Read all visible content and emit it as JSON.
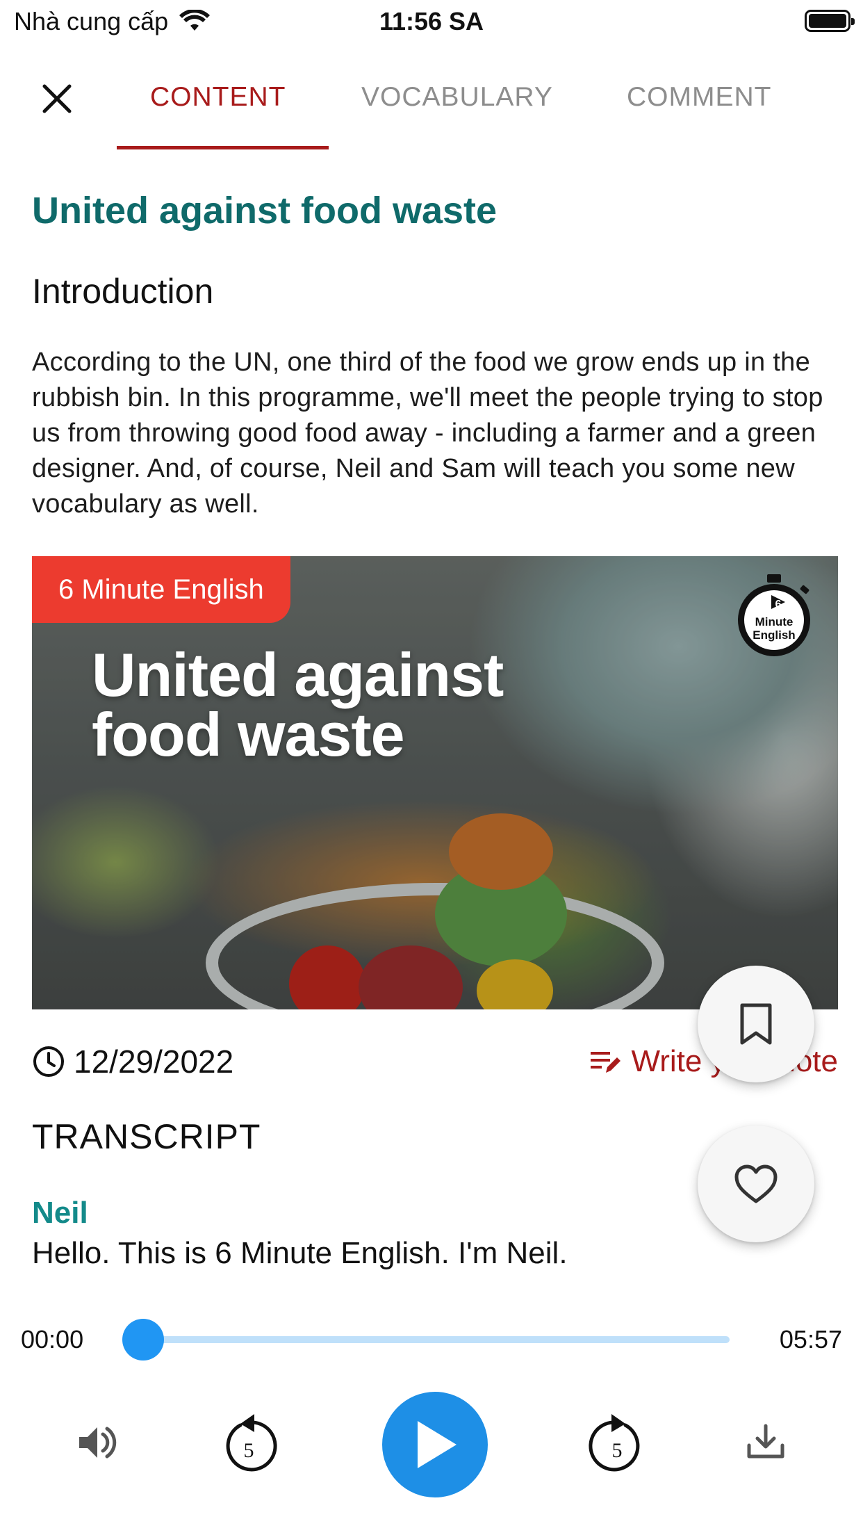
{
  "status_bar": {
    "carrier": "Nhà cung cấp",
    "time": "11:56 SA"
  },
  "tabs": [
    {
      "label": "CONTENT",
      "active": true
    },
    {
      "label": "VOCABULARY",
      "active": false
    },
    {
      "label": "COMMENT",
      "active": false
    }
  ],
  "article": {
    "title": "United against food waste",
    "intro_heading": "Introduction",
    "intro_body": "According to the UN, one third of the food we grow ends up in the rubbish bin. In this programme, we'll meet the people trying to stop us from throwing good food away - including a farmer and a green designer. And, of course, Neil and Sam will teach you some new vocabulary as well.",
    "image": {
      "badge": "6 Minute English",
      "overlay_title": "United against food waste",
      "logo_text_1": "Minute",
      "logo_text_2": "English",
      "logo_number": "6"
    },
    "date": "12/29/2022",
    "note_link": "Write your note"
  },
  "transcript": {
    "heading": "TRANSCRIPT",
    "speaker": "Neil",
    "line": "Hello. This is 6 Minute English. I'm Neil."
  },
  "player": {
    "current_time": "00:00",
    "duration": "05:57",
    "progress": 0,
    "rewind_seconds": "5",
    "forward_seconds": "5"
  },
  "colors": {
    "accent_red": "#a81b1b",
    "title_teal": "#0f6a6a",
    "speaker_teal": "#138a8a",
    "player_blue": "#1e8fe6",
    "badge_red": "#ec3b2f"
  },
  "icons": {
    "close": "close-icon",
    "wifi": "wifi-icon",
    "battery": "battery-icon",
    "clock": "clock-icon",
    "note": "edit-note-icon",
    "bookmark": "bookmark-icon",
    "heart": "heart-icon",
    "volume": "volume-icon",
    "rewind": "replay-5-icon",
    "forward": "forward-5-icon",
    "play": "play-icon",
    "download": "download-icon"
  }
}
